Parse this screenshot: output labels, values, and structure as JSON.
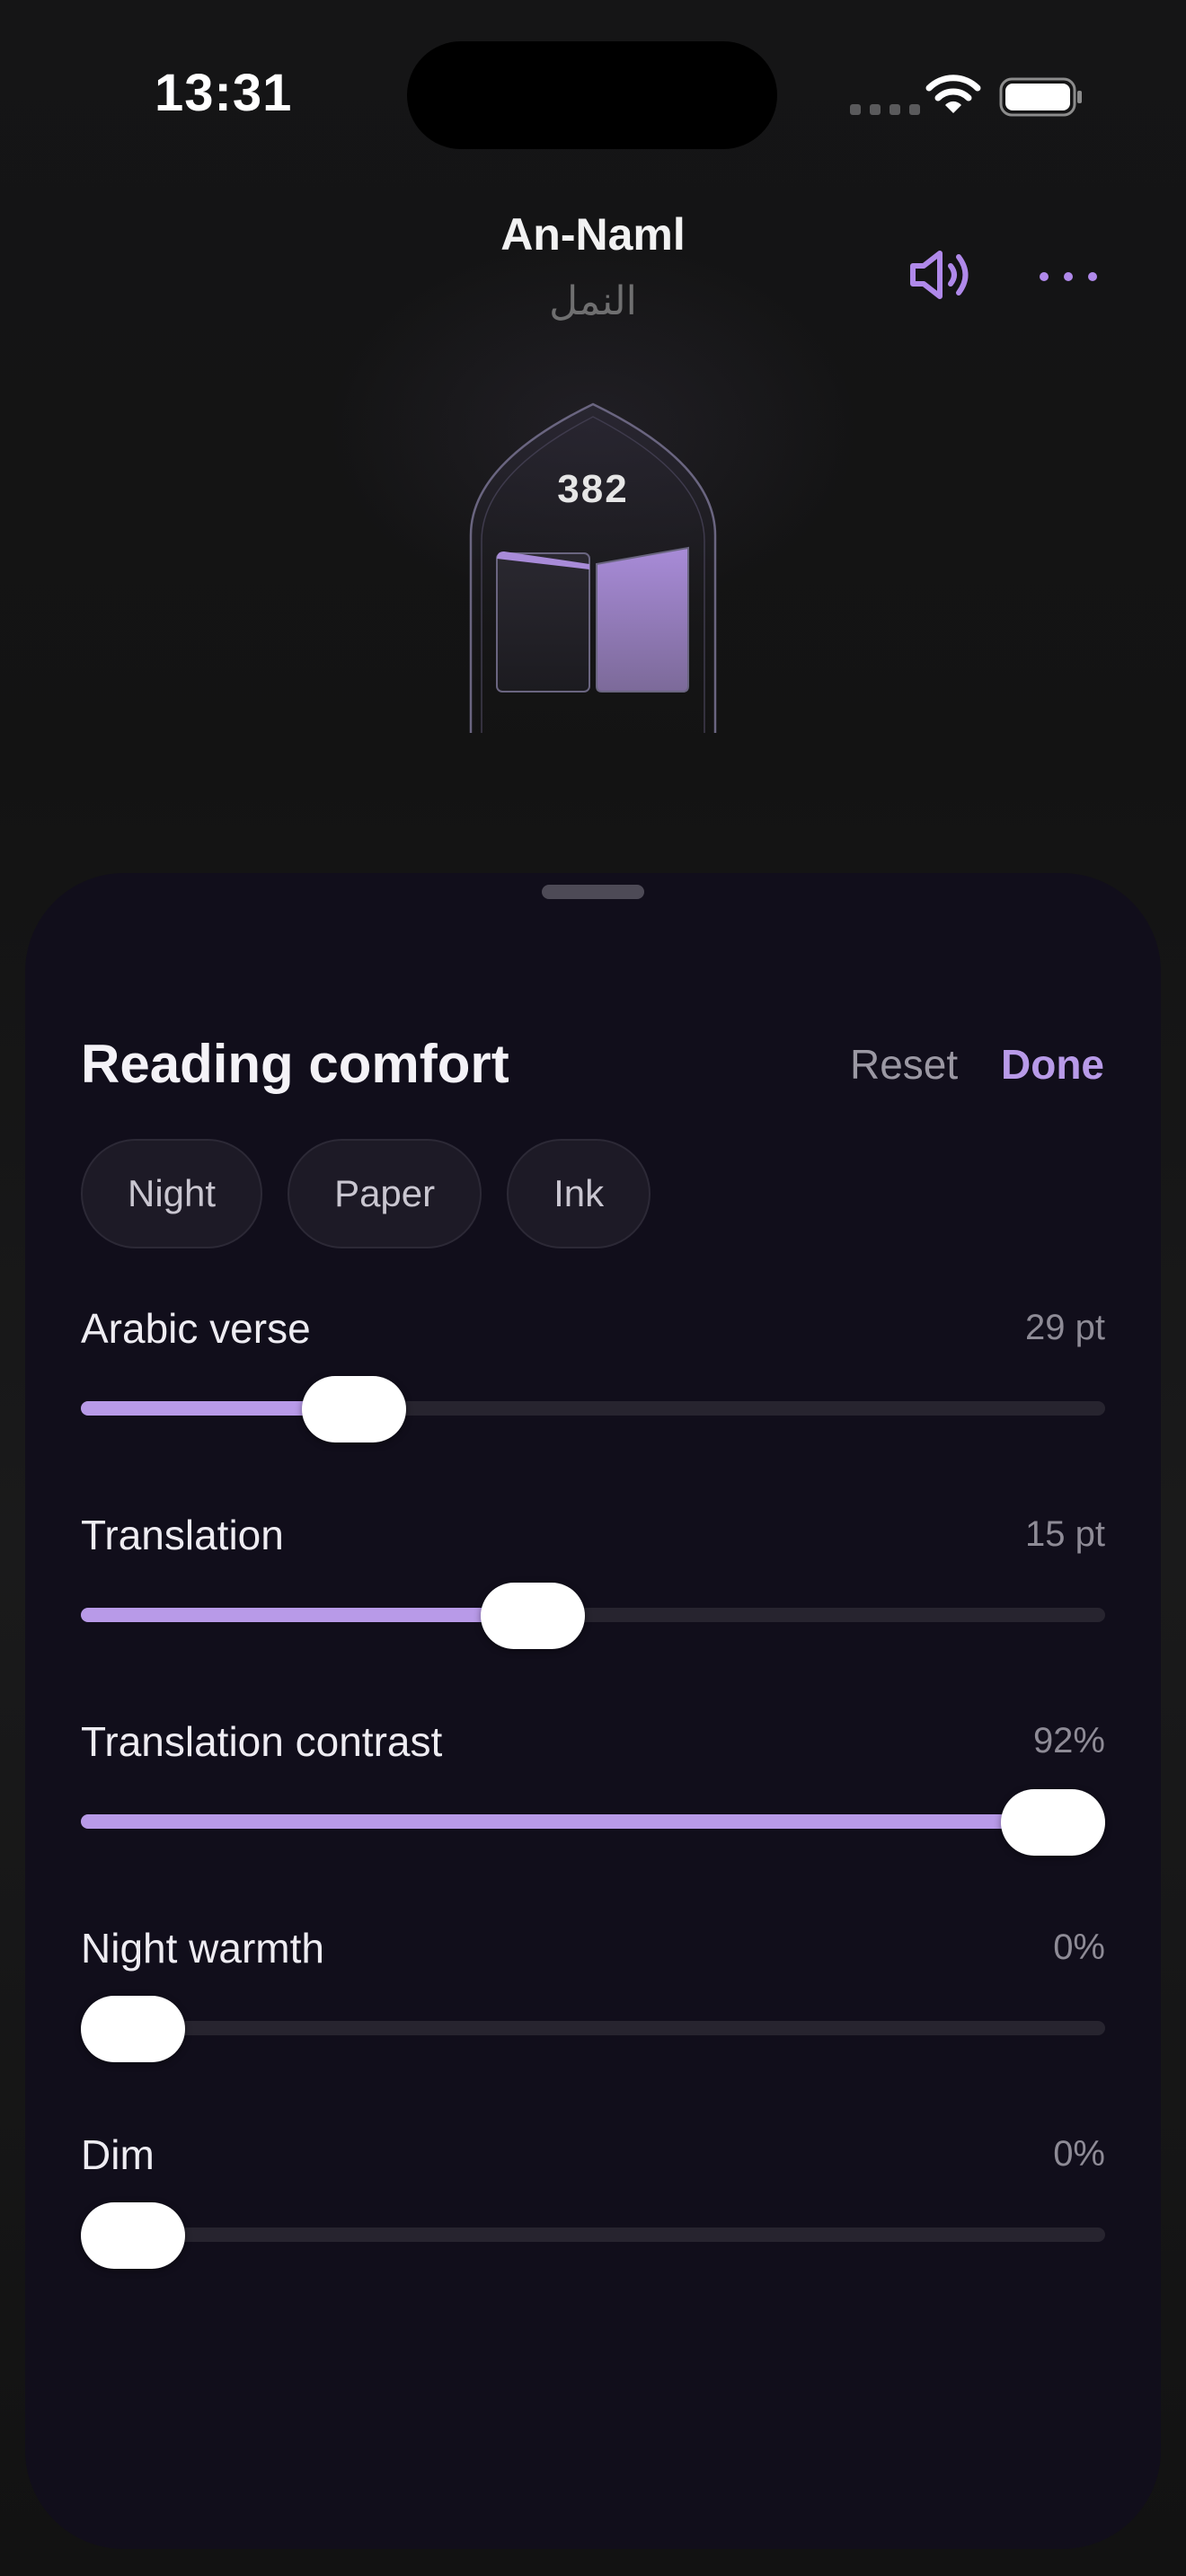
{
  "status_bar": {
    "time": "13:31",
    "icons": [
      "cellular-signal-icon",
      "wifi-icon",
      "battery-icon"
    ]
  },
  "header": {
    "title": "An-Naml",
    "subtitle_arabic": "النمل",
    "page_number": "382",
    "speaker_icon": "speaker-icon",
    "more_icon": "more-icon"
  },
  "sheet": {
    "title": "Reading comfort",
    "reset_label": "Reset",
    "done_label": "Done",
    "presets": [
      "Night",
      "Paper",
      "Ink"
    ],
    "sliders": [
      {
        "label": "Arabic verse",
        "value_text": "29 pt",
        "fraction": 0.24
      },
      {
        "label": "Translation",
        "value_text": "15 pt",
        "fraction": 0.435
      },
      {
        "label": "Translation contrast",
        "value_text": "92%",
        "fraction": 1.0
      },
      {
        "label": "Night warmth",
        "value_text": "0%",
        "fraction": 0.0
      },
      {
        "label": "Dim",
        "value_text": "0%",
        "fraction": 0.0
      }
    ]
  },
  "colors": {
    "accent": "#b89ae8",
    "sheet_background": "#110e1b",
    "track": "#27242f",
    "thumb": "#ffffff"
  }
}
